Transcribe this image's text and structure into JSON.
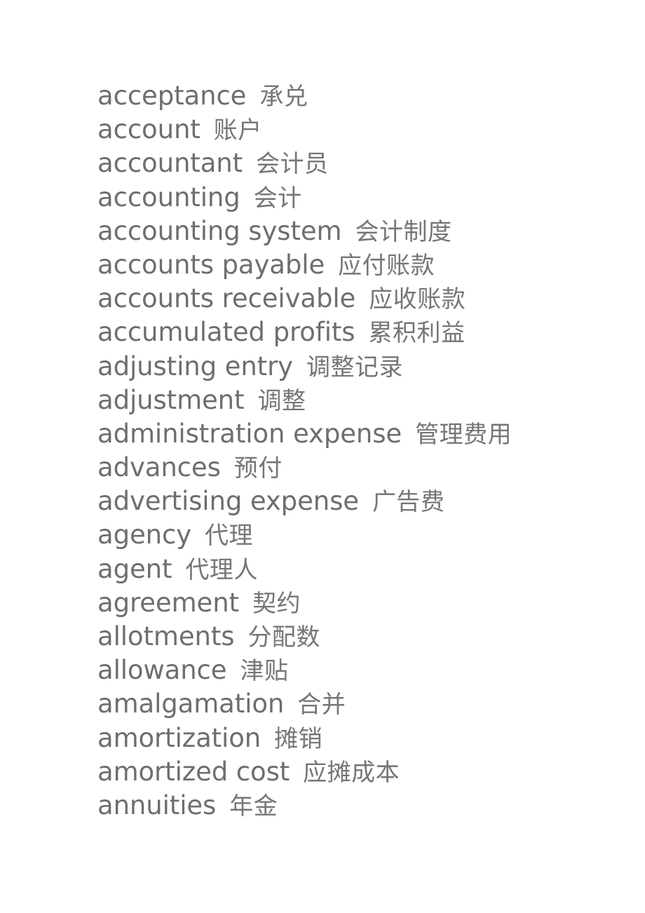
{
  "document": {
    "kind": "bilingual-glossary",
    "background_color": "#ffffff",
    "text_color": "#6e6e6e",
    "entries": [
      {
        "en": "acceptance",
        "zh": "承兑"
      },
      {
        "en": "account",
        "zh": "账户"
      },
      {
        "en": "accountant",
        "zh": "会计员"
      },
      {
        "en": "accounting",
        "zh": "会计"
      },
      {
        "en": "accounting system",
        "zh": "会计制度"
      },
      {
        "en": "accounts payable",
        "zh": "应付账款"
      },
      {
        "en": "accounts receivable",
        "zh": "应收账款"
      },
      {
        "en": "accumulated profits",
        "zh": "累积利益"
      },
      {
        "en": "adjusting entry",
        "zh": "调整记录"
      },
      {
        "en": "adjustment",
        "zh": "调整"
      },
      {
        "en": "administration expense",
        "zh": "管理费用"
      },
      {
        "en": "advances",
        "zh": "预付"
      },
      {
        "en": "advertising expense",
        "zh": "广告费"
      },
      {
        "en": "agency",
        "zh": "代理"
      },
      {
        "en": "agent",
        "zh": "代理人"
      },
      {
        "en": "agreement",
        "zh": "契约"
      },
      {
        "en": "allotments",
        "zh": "分配数"
      },
      {
        "en": "allowance",
        "zh": "津贴"
      },
      {
        "en": "amalgamation",
        "zh": "合并"
      },
      {
        "en": "amortization",
        "zh": "摊销"
      },
      {
        "en": "amortized cost",
        "zh": "应摊成本"
      },
      {
        "en": "annuities",
        "zh": "年金"
      }
    ]
  }
}
